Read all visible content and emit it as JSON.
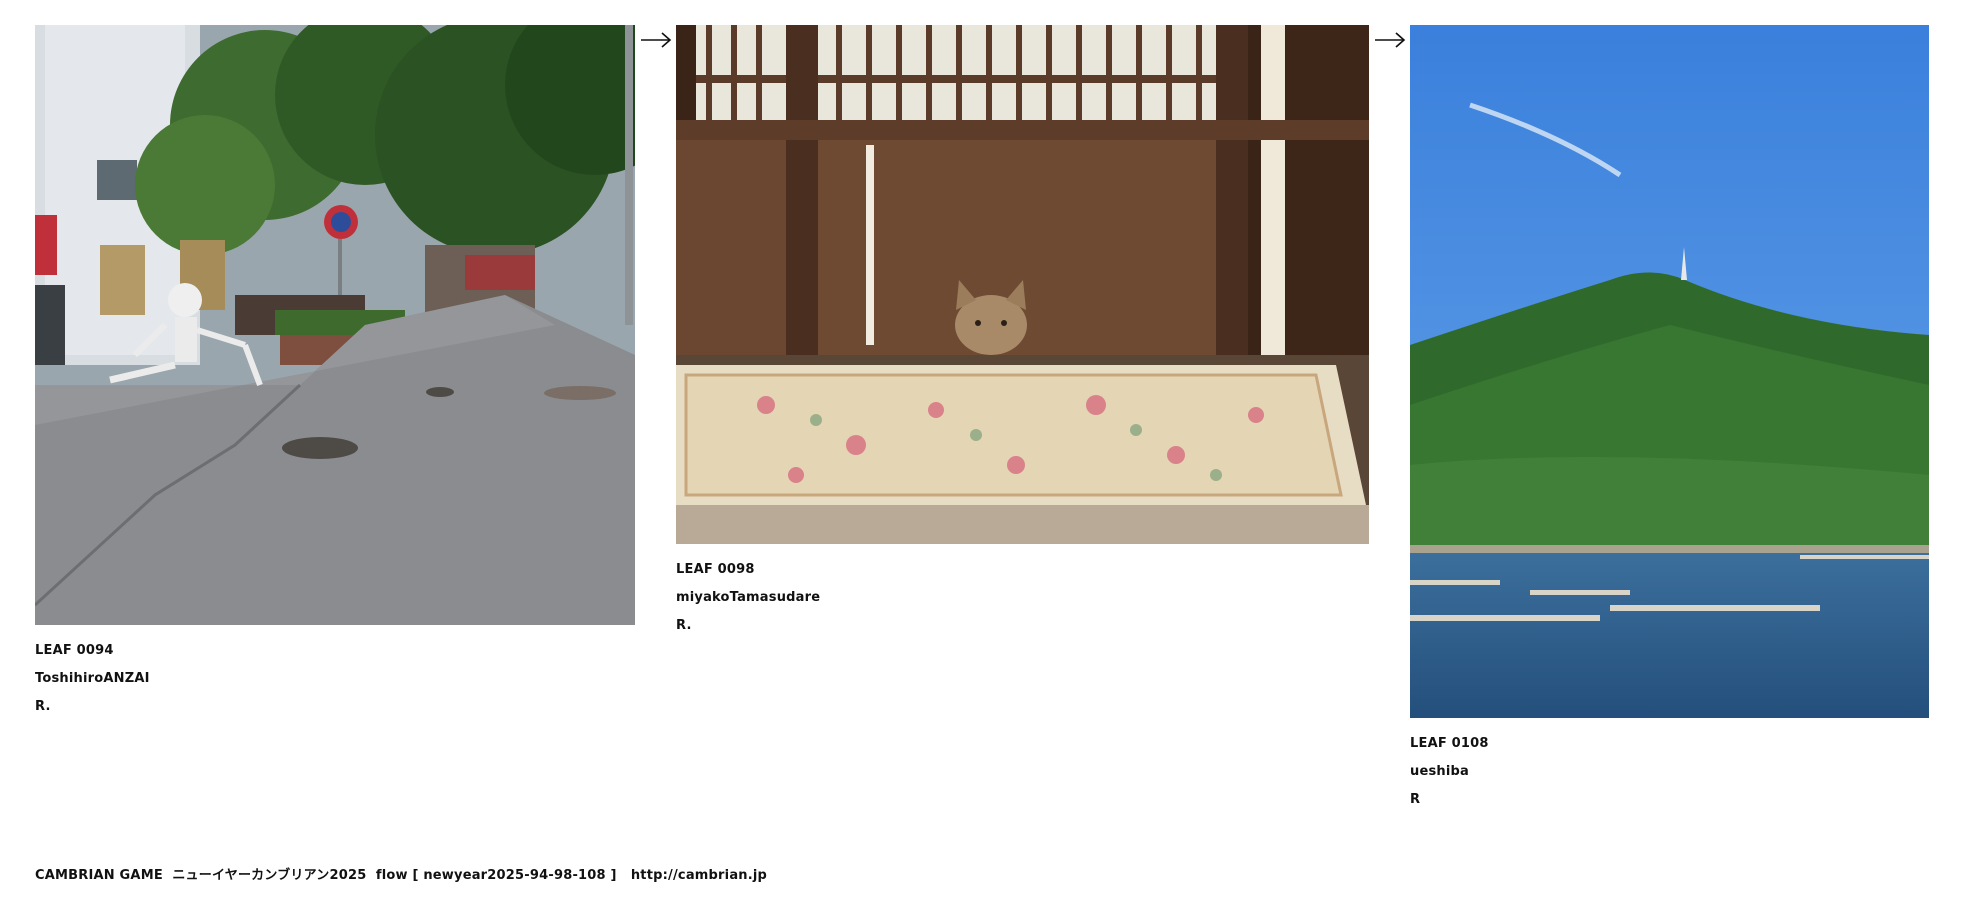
{
  "leaves": [
    {
      "id": "LEAF 0094",
      "author": "ToshihiroANZAI",
      "mark": "R.",
      "photo_subject": "street-corner-with-skeleton-photo"
    },
    {
      "id": "LEAF 0098",
      "author": "miyakoTamasudare",
      "mark": "R.",
      "photo_subject": "cat-behind-wooden-door-photo"
    },
    {
      "id": "LEAF 0108",
      "author": "ueshiba",
      "mark": "R",
      "photo_subject": "green-mountain-and-sea-photo"
    }
  ],
  "arrows": [
    "right-arrow-icon",
    "right-arrow-icon"
  ],
  "footer": {
    "title": "CAMBRIAN GAME  ニューイヤーカンブリアン2025  flow [ newyear2025-94-98-108 ]",
    "url": "http://cambrian.jp"
  },
  "colors": {
    "text": "#111111",
    "background": "#ffffff",
    "sky": "#3f86df",
    "mountain": "#2f6a2c",
    "sea": "#2d5f8f"
  }
}
